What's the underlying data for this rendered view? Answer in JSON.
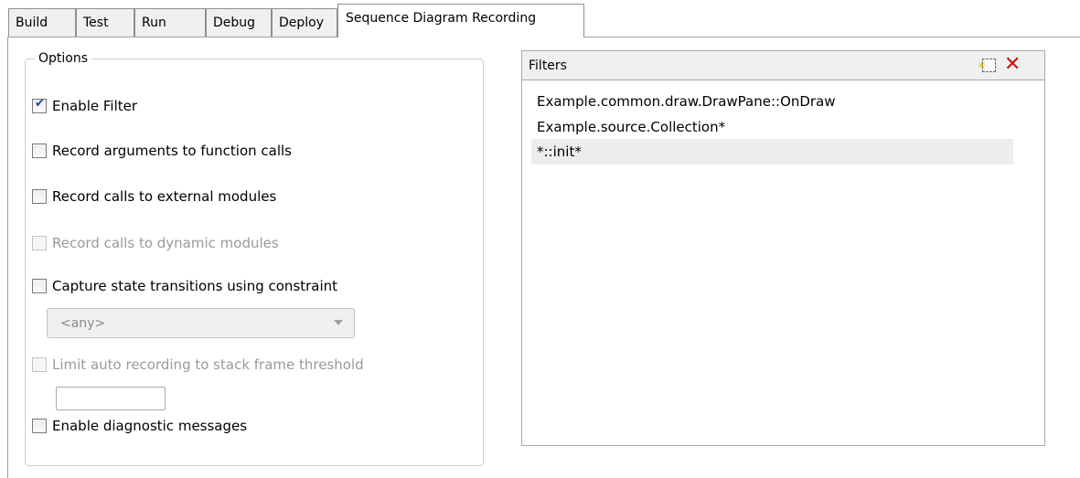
{
  "tabs": [
    {
      "label": "Build",
      "active": false
    },
    {
      "label": "Test",
      "active": false
    },
    {
      "label": "Run",
      "active": false
    },
    {
      "label": "Debug",
      "active": false
    },
    {
      "label": "Deploy",
      "active": false
    },
    {
      "label": "Sequence Diagram Recording",
      "active": true
    }
  ],
  "options": {
    "title": "Options",
    "enable_filter": {
      "label": "Enable Filter",
      "checked": true,
      "enabled": true
    },
    "record_arguments": {
      "label": "Record arguments to function calls",
      "checked": false,
      "enabled": true
    },
    "record_external": {
      "label": "Record calls to external modules",
      "checked": false,
      "enabled": true
    },
    "record_dynamic": {
      "label": "Record calls to dynamic modules",
      "checked": false,
      "enabled": false
    },
    "capture_state": {
      "label": "Capture state transitions using constraint",
      "checked": false,
      "enabled": true
    },
    "constraint_select": {
      "value": "<any>",
      "enabled": false
    },
    "limit_recording": {
      "label": "Limit auto recording to stack frame threshold",
      "checked": false,
      "enabled": false
    },
    "threshold_value": "",
    "enable_diagnostic": {
      "label": "Enable diagnostic messages",
      "checked": false,
      "enabled": true
    }
  },
  "filters": {
    "title": "Filters",
    "new_icon": "new-item-icon",
    "delete_icon": "delete-icon",
    "items": [
      {
        "text": "Example.common.draw.DrawPane::OnDraw",
        "selected": false
      },
      {
        "text": "Example.source.Collection*",
        "selected": false
      },
      {
        "text": "*::init*",
        "selected": true
      }
    ]
  },
  "colors": {
    "delete_icon": "#c8140c",
    "selected_row": "#ededed"
  }
}
